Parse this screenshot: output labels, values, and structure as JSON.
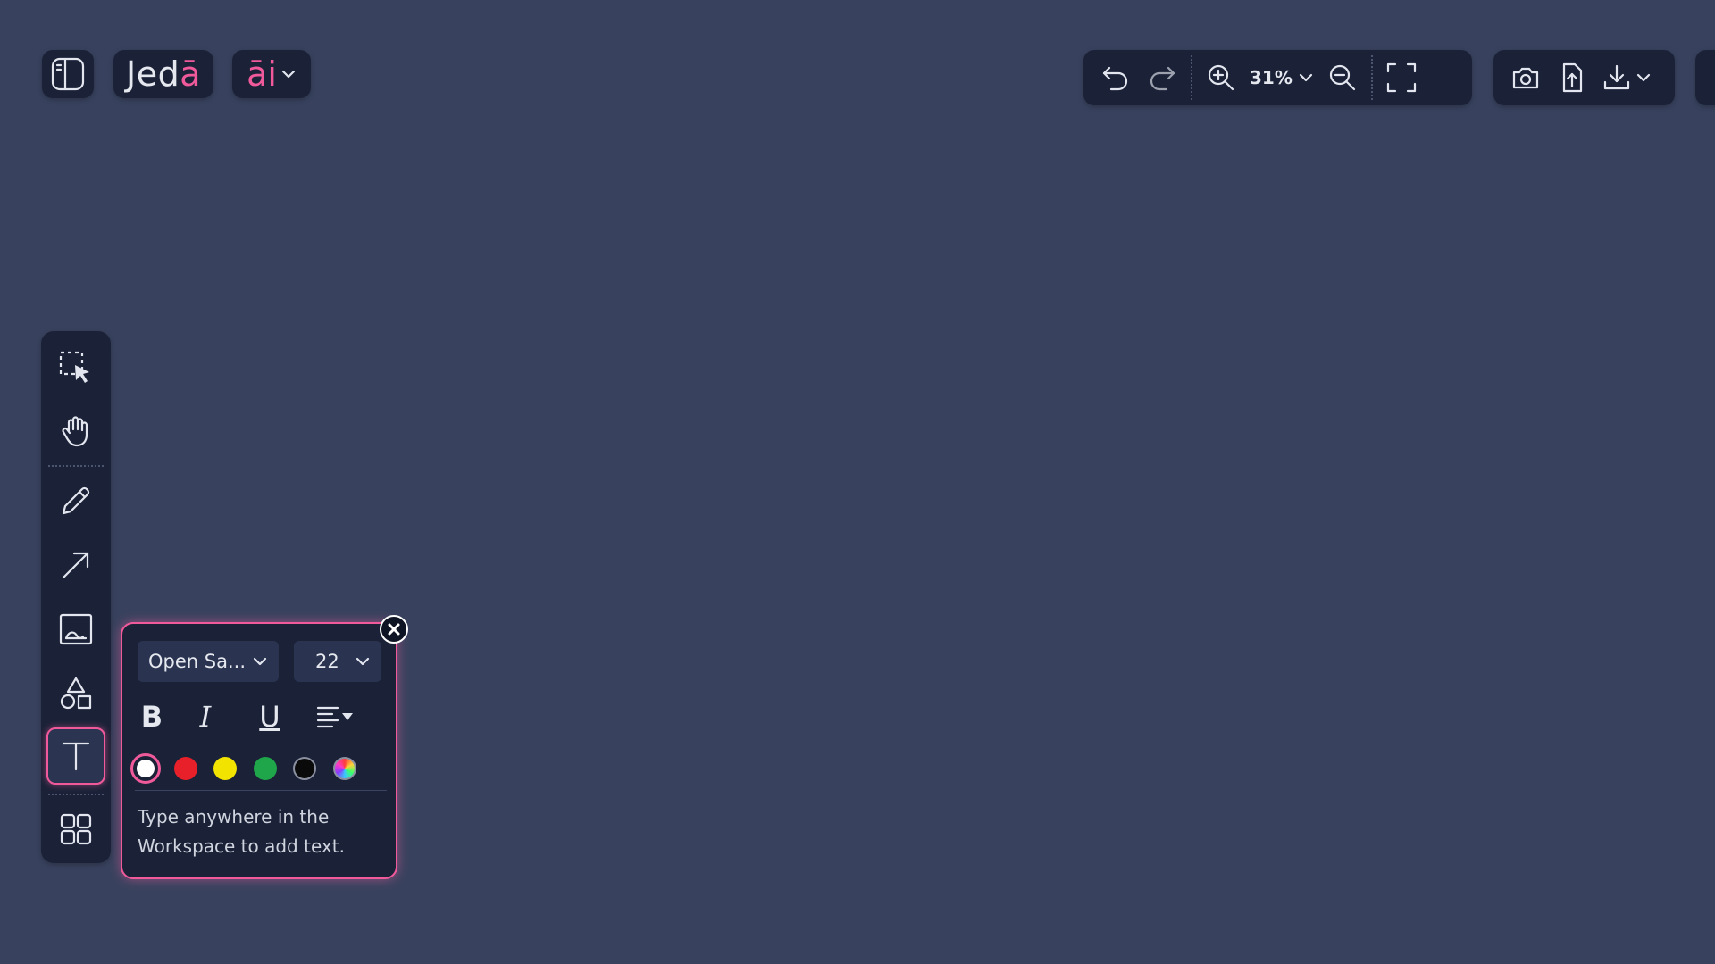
{
  "brand": {
    "logo_main": "Jed",
    "logo_accent": "ā",
    "ai_label": "āi",
    "accent_color": "#f05a9b"
  },
  "top_toolbar": {
    "zoom_level": "31%",
    "icons": [
      "undo-icon",
      "redo-icon",
      "zoom-in-icon",
      "zoom-out-icon",
      "fullscreen-icon"
    ]
  },
  "export_toolbar": {
    "icons": [
      "camera-icon",
      "upload-icon",
      "download-icon"
    ]
  },
  "left_toolbar": {
    "tools": [
      "select",
      "pan",
      "pencil",
      "arrow",
      "image",
      "shapes",
      "text",
      "templates"
    ],
    "active_tool": "text"
  },
  "text_popover": {
    "font_family": "Open Sa...",
    "font_size": "22",
    "bold_label": "B",
    "italic_label": "I",
    "underline_label": "U",
    "colors": [
      "#ffffff",
      "#e8202a",
      "#f2e400",
      "#1fa64a",
      "#0a0a0a",
      "rainbow"
    ],
    "selected_color": "#ffffff",
    "hint": "Type anywhere in the Workspace to add text."
  }
}
